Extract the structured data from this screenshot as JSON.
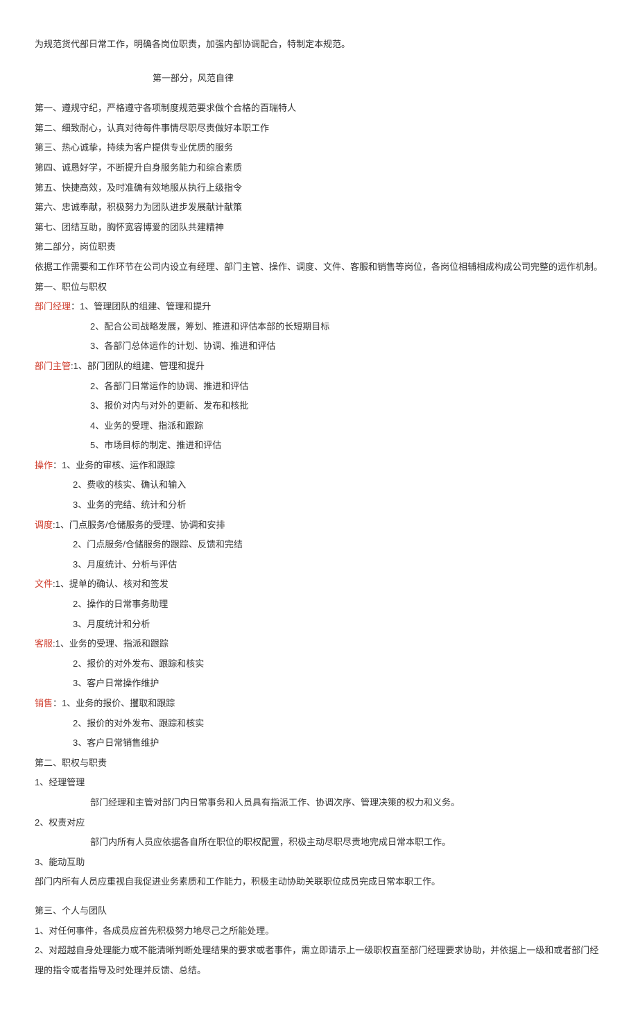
{
  "intro": "为规范货代部日常工作，明确各岗位职责，加强内部协调配合，特制定本规范。",
  "part1_title": "第一部分，风范自律",
  "part1_items": [
    "第一、遵规守纪，严格遵守各项制度规范要求做个合格的百瑞特人",
    "第二、细致耐心，认真对待每件事情尽职尽责做好本职工作",
    "第三、热心诚挚，持续为客户提供专业优质的服务",
    "第四、诚恳好学，不断提升自身服务能力和综合素质",
    "第五、快捷高效，及时准确有效地服从执行上级指令",
    "第六、忠诚奉献，积极努力为团队进步发展献计献策",
    "第七、团结互助，胸怀宽容博爱的团队共建精神"
  ],
  "part2_heading": "第二部分，岗位职责",
  "part2_intro": "依据工作需要和工作环节在公司内设立有经理、部门主管、操作、调度、文件、客服和销售等岗位，各岗位相辅相成构成公司完整的运作机制。",
  "sec1_title": "第一、职位与职权",
  "roles": [
    {
      "label": "部门经理",
      "sep": "：",
      "first": "1、管理团队的组建、管理和提升",
      "rest": [
        "2、配合公司战略发展，筹划、推进和评估本部的长短期目标",
        "3、各部门总体运作的计划、协调、推进和评估"
      ]
    },
    {
      "label": "部门主管",
      "sep": ":",
      "first": "1、部门团队的组建、管理和提升",
      "rest": [
        "2、各部门日常运作的协调、推进和评估",
        "3、报价对内与对外的更新、发布和核批",
        "4、业务的受理、指派和跟踪",
        "5、市场目标的制定、推进和评估"
      ]
    },
    {
      "label": "操作",
      "sep": "：",
      "first": "1、业务的审核、运作和跟踪",
      "rest": [
        "2、费收的核实、确认和输入",
        "3、业务的完结、统计和分析"
      ]
    },
    {
      "label": "调度",
      "sep": ":",
      "first": "1、门点服务/仓储服务的受理、协调和安排",
      "rest": [
        "2、门点服务/仓储服务的跟踪、反馈和完结",
        "3、月度统计、分析与评估"
      ]
    },
    {
      "label": "文件",
      "sep": ":",
      "first": "1、提单的确认、核对和签发",
      "rest": [
        "2、操作的日常事务助理",
        "3、月度统计和分析"
      ]
    },
    {
      "label": "客服",
      "sep": ":",
      "first": "1、业务的受理、指派和跟踪",
      "rest": [
        "2、报价的对外发布、跟踪和核实",
        "3、客户日常操作维护"
      ]
    },
    {
      "label": "销售",
      "sep": "：",
      "first": "1、业务的报价、攫取和跟踪",
      "rest": [
        "2、报价的对外发布、跟踪和核实",
        "3、客户日常销售维护"
      ]
    }
  ],
  "sec2_title": "第二、职权与职责",
  "sec2_items": [
    {
      "title": "1、经理管理",
      "body": "部门经理和主管对部门内日常事务和人员具有指派工作、协调次序、管理决策的权力和义务。"
    },
    {
      "title": "2、权责对应",
      "body": "部门内所有人员应依据各自所在职位的职权配置，积极主动尽职尽责地完成日常本职工作。"
    },
    {
      "title": "3、能动互助",
      "body_noindent": "部门内所有人员应重视自我促进业务素质和工作能力，积极主动协助关联职位成员完成日常本职工作。"
    }
  ],
  "sec3_title": "第三、个人与团队",
  "sec3_items": [
    "1、对任何事件，各成员应首先积极努力地尽己之所能处理。",
    "2、对超越自身处理能力或不能清晰判断处理结果的要求或者事件，需立即请示上一级职权直至部门经理要求协助，并依据上一级和或者部门经理的指令或者指导及时处理并反馈、总结。"
  ]
}
